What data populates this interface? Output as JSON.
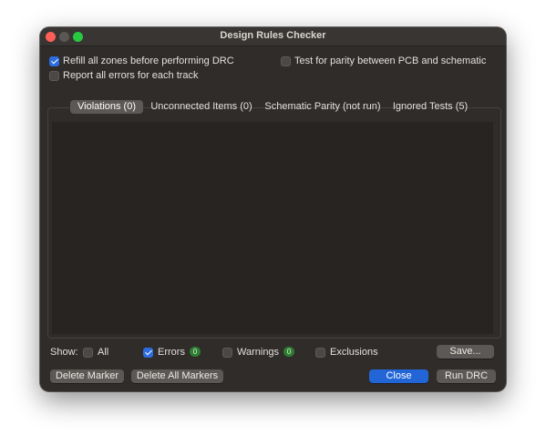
{
  "window": {
    "title": "Design Rules Checker"
  },
  "options": {
    "refill_zones": {
      "label": "Refill all zones before performing DRC",
      "checked": true
    },
    "report_all_errors": {
      "label": "Report all errors for each track",
      "checked": false
    },
    "test_parity": {
      "label": "Test for parity between PCB and schematic",
      "checked": false
    }
  },
  "tabs": [
    {
      "label": "Violations (0)",
      "selected": true
    },
    {
      "label": "Unconnected Items (0)",
      "selected": false
    },
    {
      "label": "Schematic Parity (not run)",
      "selected": false
    },
    {
      "label": "Ignored Tests (5)",
      "selected": false
    }
  ],
  "show": {
    "label": "Show:",
    "all": {
      "label": "All",
      "checked": false
    },
    "errors": {
      "label": "Errors",
      "checked": true,
      "count": "0"
    },
    "warnings": {
      "label": "Warnings",
      "checked": false,
      "count": "0"
    },
    "exclusions": {
      "label": "Exclusions",
      "checked": false
    }
  },
  "buttons": {
    "save": "Save...",
    "delete_marker": "Delete Marker",
    "delete_all_markers": "Delete All Markers",
    "close": "Close",
    "run_drc": "Run DRC"
  },
  "colors": {
    "accent": "#2265d6",
    "badge": "#2e7d32",
    "window_bg": "#2f2c2a"
  }
}
